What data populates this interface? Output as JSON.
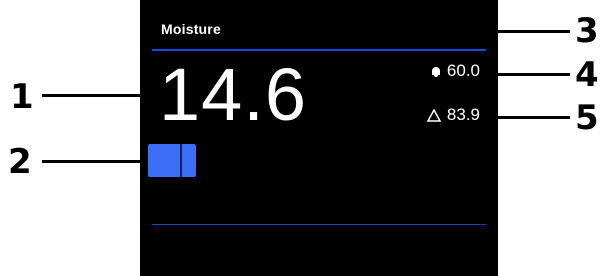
{
  "panel": {
    "title": "Moisture",
    "subtitle": "",
    "value": "14.6",
    "high_limit": "60.0",
    "deviation_limit": "83.9"
  },
  "icons": {
    "high_limit_icon": "bell-icon",
    "deviation_icon": "delta-icon"
  },
  "colors": {
    "screen_background": "#000000",
    "accent_rule": "#1e49d8",
    "indicator": "#3b6df5",
    "text": "#ffffff"
  },
  "callouts": {
    "c1": "1",
    "c2": "2",
    "c3": "3",
    "c4": "4",
    "c5": "5"
  }
}
